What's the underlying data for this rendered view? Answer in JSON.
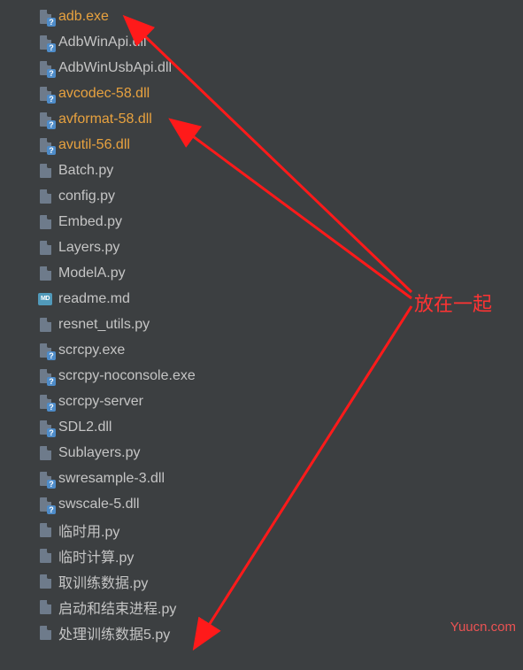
{
  "files": [
    {
      "name": "adb.exe",
      "type": "generic",
      "highlighted": true
    },
    {
      "name": "AdbWinApi.dll",
      "type": "generic",
      "highlighted": false
    },
    {
      "name": "AdbWinUsbApi.dll",
      "type": "generic",
      "highlighted": false
    },
    {
      "name": "avcodec-58.dll",
      "type": "generic",
      "highlighted": true
    },
    {
      "name": "avformat-58.dll",
      "type": "generic",
      "highlighted": true
    },
    {
      "name": "avutil-56.dll",
      "type": "generic",
      "highlighted": true
    },
    {
      "name": "Batch.py",
      "type": "python",
      "highlighted": false
    },
    {
      "name": "config.py",
      "type": "python",
      "highlighted": false
    },
    {
      "name": "Embed.py",
      "type": "python",
      "highlighted": false
    },
    {
      "name": "Layers.py",
      "type": "python",
      "highlighted": false
    },
    {
      "name": "ModelA.py",
      "type": "python",
      "highlighted": false
    },
    {
      "name": "readme.md",
      "type": "markdown",
      "highlighted": false
    },
    {
      "name": "resnet_utils.py",
      "type": "python",
      "highlighted": false
    },
    {
      "name": "scrcpy.exe",
      "type": "generic",
      "highlighted": false
    },
    {
      "name": "scrcpy-noconsole.exe",
      "type": "generic",
      "highlighted": false
    },
    {
      "name": "scrcpy-server",
      "type": "generic",
      "highlighted": false
    },
    {
      "name": "SDL2.dll",
      "type": "generic",
      "highlighted": false
    },
    {
      "name": "Sublayers.py",
      "type": "python",
      "highlighted": false
    },
    {
      "name": "swresample-3.dll",
      "type": "generic",
      "highlighted": false
    },
    {
      "name": "swscale-5.dll",
      "type": "generic",
      "highlighted": false
    },
    {
      "name": "临时用.py",
      "type": "python",
      "highlighted": false
    },
    {
      "name": "临时计算.py",
      "type": "python",
      "highlighted": false
    },
    {
      "name": "取训练数据.py",
      "type": "python",
      "highlighted": false
    },
    {
      "name": "启动和结束进程.py",
      "type": "python",
      "highlighted": false
    },
    {
      "name": "处理训练数据5.py",
      "type": "python",
      "highlighted": false
    }
  ],
  "annotation": "放在一起",
  "watermark": "Yuucn.com",
  "colors": {
    "highlight": "#e8a23f",
    "arrow": "#ff1a1a"
  }
}
